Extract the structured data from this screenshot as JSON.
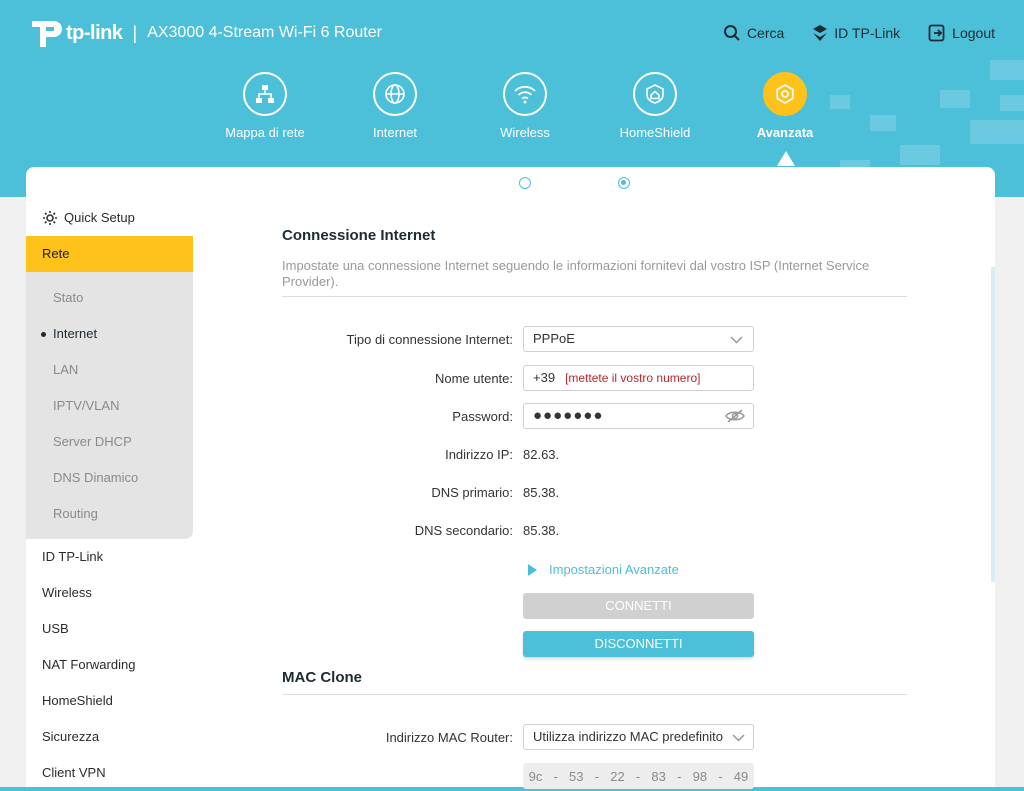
{
  "header": {
    "brand": "tp-link",
    "separator": "|",
    "model": "AX3000 4-Stream Wi-Fi 6 Router",
    "links": {
      "search": "Cerca",
      "tplink_id": "ID TP-Link",
      "logout": "Logout"
    },
    "nav": [
      {
        "label": "Mappa di rete",
        "icon": "network-map-icon"
      },
      {
        "label": "Internet",
        "icon": "globe-icon"
      },
      {
        "label": "Wireless",
        "icon": "wifi-icon"
      },
      {
        "label": "HomeShield",
        "icon": "homeshield-icon"
      },
      {
        "label": "Avanzata",
        "icon": "advanced-gear-icon",
        "active": true
      }
    ],
    "colors": {
      "primary": "#4cbfd9",
      "accent": "#ffc21a"
    }
  },
  "sidebar": {
    "quick_setup": "Quick Setup",
    "rete": "Rete",
    "rete_sub": [
      "Stato",
      "Internet",
      "LAN",
      "IPTV/VLAN",
      "Server DHCP",
      "DNS Dinamico",
      "Routing"
    ],
    "current_sub": "Internet",
    "items": [
      "ID TP-Link",
      "Wireless",
      "USB",
      "NAT Forwarding",
      "HomeShield",
      "Sicurezza",
      "Client VPN"
    ]
  },
  "main": {
    "connection": {
      "title": "Connessione Internet",
      "description": "Impostate una connessione Internet seguendo le informazioni fornitevi dal vostro ISP (Internet Service Provider).",
      "type_label": "Tipo di connessione Internet:",
      "type_value": "PPPoE",
      "username_label": "Nome utente:",
      "username_value": "+39",
      "username_hint": "[mettete il vostro numero]",
      "password_label": "Password:",
      "password_value": "●●●●●●●",
      "ip_label": "Indirizzo IP:",
      "ip_value": "82.63.",
      "dns1_label": "DNS primario:",
      "dns1_value": "85.38.",
      "dns2_label": "DNS secondario:",
      "dns2_value": "85.38.",
      "advanced_link": "Impostazioni Avanzate",
      "connect_button": "CONNETTI",
      "disconnect_button": "DISCONNETTI"
    },
    "mac_clone": {
      "title": "MAC Clone",
      "router_mac_label": "Indirizzo MAC Router:",
      "router_mac_value": "Utilizza indirizzo MAC predefinito",
      "mac_parts": [
        "9c",
        "-",
        "53",
        "-",
        "22",
        "-",
        "83",
        "-",
        "98",
        "-",
        "49"
      ]
    }
  }
}
